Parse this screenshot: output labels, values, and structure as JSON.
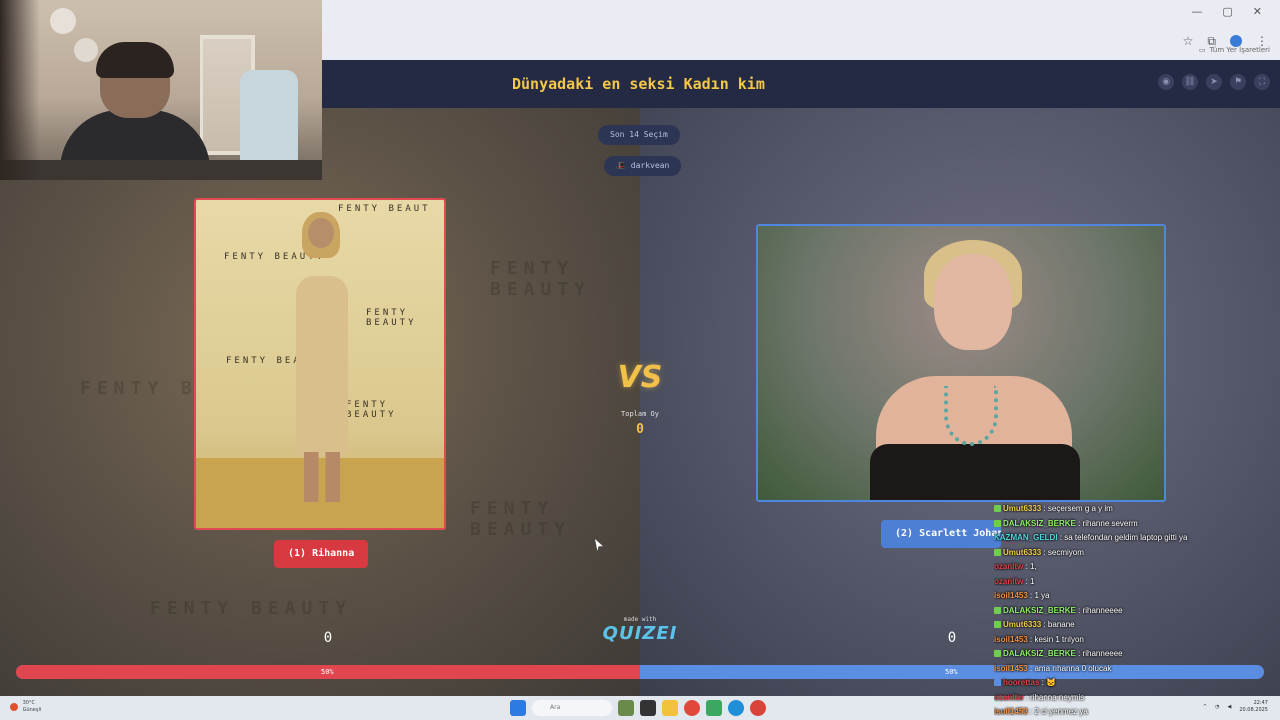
{
  "browser": {
    "bookmark_label": "Tüm Yer İşaretleri",
    "window_controls": [
      "—",
      "▢",
      "✕"
    ]
  },
  "header": {
    "title": "Dünyadaki en seksi Kadın kim",
    "icons": [
      "eye-icon",
      "link-icon",
      "send-icon",
      "flag-icon",
      "fullscreen-icon"
    ]
  },
  "battle": {
    "last_picks": "Son 14 Seçim",
    "user_tag": "🎩 darkvean",
    "vs_label": "VS",
    "total_label": "Toplam Oy",
    "total_value": "0",
    "left": {
      "name": "(1) Rihanna",
      "score": "0",
      "percent_label": "50%",
      "percent_value": 50,
      "color": "#e04550",
      "backdrop_text": [
        "FENTY BEAUT",
        "FENTY BEAUTY",
        "FENTY BEAUTY",
        "FENTY BEAUTY",
        "FENTY BEAUTY"
      ]
    },
    "right": {
      "name": "(2) Scarlett Johansson",
      "score": "0",
      "percent_label": "50%",
      "color": "#5b8ee0"
    },
    "made_with": "made with",
    "brand": "QUIZEI"
  },
  "chat": [
    {
      "user": "Umut6333",
      "msg": " : seçersem g a y im",
      "color": "#f5d342",
      "badge": "#6fcf4a"
    },
    {
      "user": "DALAKSIZ_BERKE",
      "msg": " : rihanne severm",
      "color": "#8ef06a",
      "badge": "#6fcf4a"
    },
    {
      "user": "KAZMAN_GELDI",
      "msg": " : sa telefondan geldim laptop gitti ya",
      "color": "#4fd8e0",
      "badge": ""
    },
    {
      "user": "Umut6333",
      "msg": " : secmiyom",
      "color": "#f5d342",
      "badge": "#6fcf4a"
    },
    {
      "user": "ozanltw",
      "msg": " : 1,",
      "color": "#e0424a",
      "badge": ""
    },
    {
      "user": "ozanltw",
      "msg": " : 1",
      "color": "#e0424a",
      "badge": ""
    },
    {
      "user": "isoil1453",
      "msg": " : 1 ya",
      "color": "#f09040",
      "badge": ""
    },
    {
      "user": "DALAKSIZ_BERKE",
      "msg": " : rihanneeee",
      "color": "#8ef06a",
      "badge": "#6fcf4a"
    },
    {
      "user": "Umut6333",
      "msg": " : banane",
      "color": "#f5d342",
      "badge": "#6fcf4a"
    },
    {
      "user": "isoil1453",
      "msg": " : kesin 1 trılyon",
      "color": "#f09040",
      "badge": ""
    },
    {
      "user": "DALAKSIZ_BERKE",
      "msg": " : rihanneeee",
      "color": "#8ef06a",
      "badge": "#6fcf4a"
    },
    {
      "user": "isoil1453",
      "msg": " : ama rıhanna 0 olucak",
      "color": "#f09040",
      "badge": ""
    },
    {
      "user": "hoorettas",
      "msg": " : 🐱",
      "color": "#e0424a",
      "badge": "#5b8ee0"
    },
    {
      "user": "ozanltw",
      "msg": " : rihanna neymis",
      "color": "#e0424a",
      "badge": ""
    },
    {
      "user": "isoil1453",
      "msg": " : 2 ci yenmez ya",
      "color": "#f09040",
      "badge": ""
    }
  ],
  "taskbar": {
    "weather_temp": "30°C",
    "weather_desc": "Güneşli",
    "search_placeholder": "Ara",
    "time": "22:47",
    "date": "20.08.2025"
  }
}
